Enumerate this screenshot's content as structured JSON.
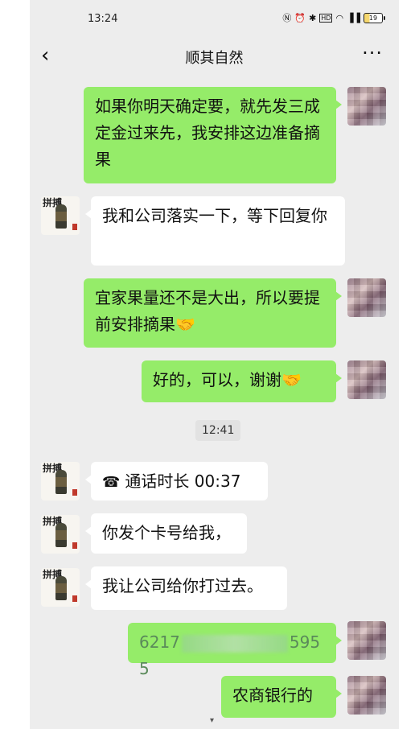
{
  "status_bar": {
    "time": "13:24",
    "battery": "19",
    "icons": [
      "nfc-icon",
      "alarm-icon",
      "bluetooth-icon",
      "hd-icon",
      "wifi-icon",
      "signal-icon",
      "battery-icon"
    ]
  },
  "nav": {
    "title": "顺其自然",
    "back_icon": "chevron-left-icon",
    "more_icon": "more-icon"
  },
  "messages": [
    {
      "from": "me",
      "text": "如果你明天确定要，就先发三成定金过来先，我安排这边准备摘果"
    },
    {
      "from": "them",
      "text": "我和公司落实一下，等下回复你"
    },
    {
      "from": "me",
      "text": "宜家果量还不是大出，所以要提前安排摘果🤝"
    },
    {
      "from": "me",
      "text": "好的，可以，谢谢🤝"
    },
    {
      "type": "time",
      "text": "12:41"
    },
    {
      "from": "them",
      "text": "通话时长 00:37",
      "icon": "phone-icon"
    },
    {
      "from": "them",
      "text": "你发个卡号给我，"
    },
    {
      "from": "them",
      "text": "我让公司给你打过去。"
    },
    {
      "from": "me",
      "text_start": "6217",
      "text_end": "5955",
      "redacted": true
    },
    {
      "from": "me",
      "text": "农商银行的"
    }
  ],
  "avatar_them_text": "拼搏",
  "colors": {
    "bubble_out": "#95ec69",
    "bubble_in": "#ffffff",
    "background": "#ededed"
  }
}
